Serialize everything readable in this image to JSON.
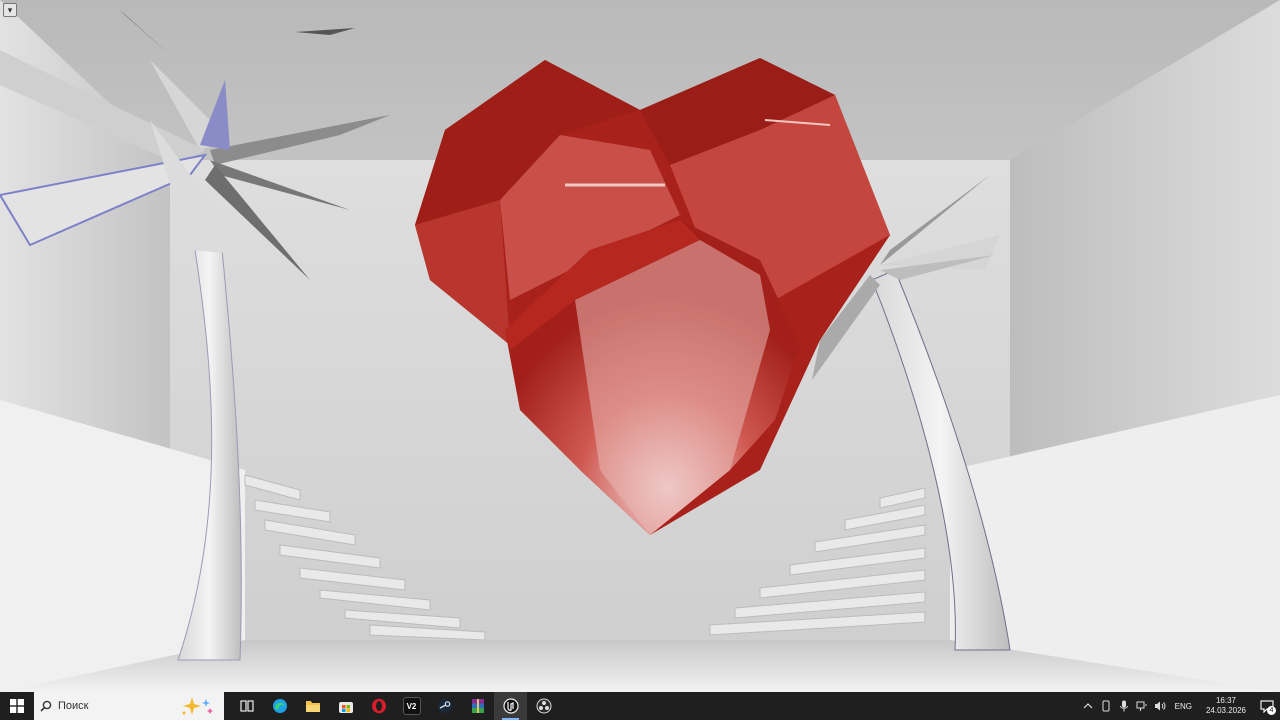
{
  "taskbar": {
    "search_placeholder": "Поиск",
    "apps": [
      {
        "id": "task-view",
        "icon": "task-view-icon"
      },
      {
        "id": "edge",
        "icon": "edge-icon",
        "color": "#1da1e6"
      },
      {
        "id": "file-explorer",
        "icon": "folder-icon",
        "color": "#f2c14e"
      },
      {
        "id": "store",
        "icon": "store-icon",
        "color": "#e8e8e8"
      },
      {
        "id": "opera",
        "icon": "opera-icon",
        "color": "#d81e2c"
      },
      {
        "id": "v2",
        "icon": "v2-app-icon",
        "label": "V2",
        "color": "#111111"
      },
      {
        "id": "steam",
        "icon": "steam-icon",
        "color": "#1b2838"
      },
      {
        "id": "winrar",
        "icon": "winrar-icon",
        "color": "#8b2a8f"
      },
      {
        "id": "unreal",
        "icon": "unreal-engine-icon",
        "color": "#111111"
      },
      {
        "id": "obs",
        "icon": "obs-icon",
        "color": "#2a2a2a"
      }
    ]
  },
  "tray": {
    "language": "ENG",
    "time": "16:37",
    "date": "24.03.2026",
    "notifications": "4"
  },
  "colors": {
    "taskbar_bg": "#1f1f1f",
    "heart_red": "#b3221a"
  }
}
